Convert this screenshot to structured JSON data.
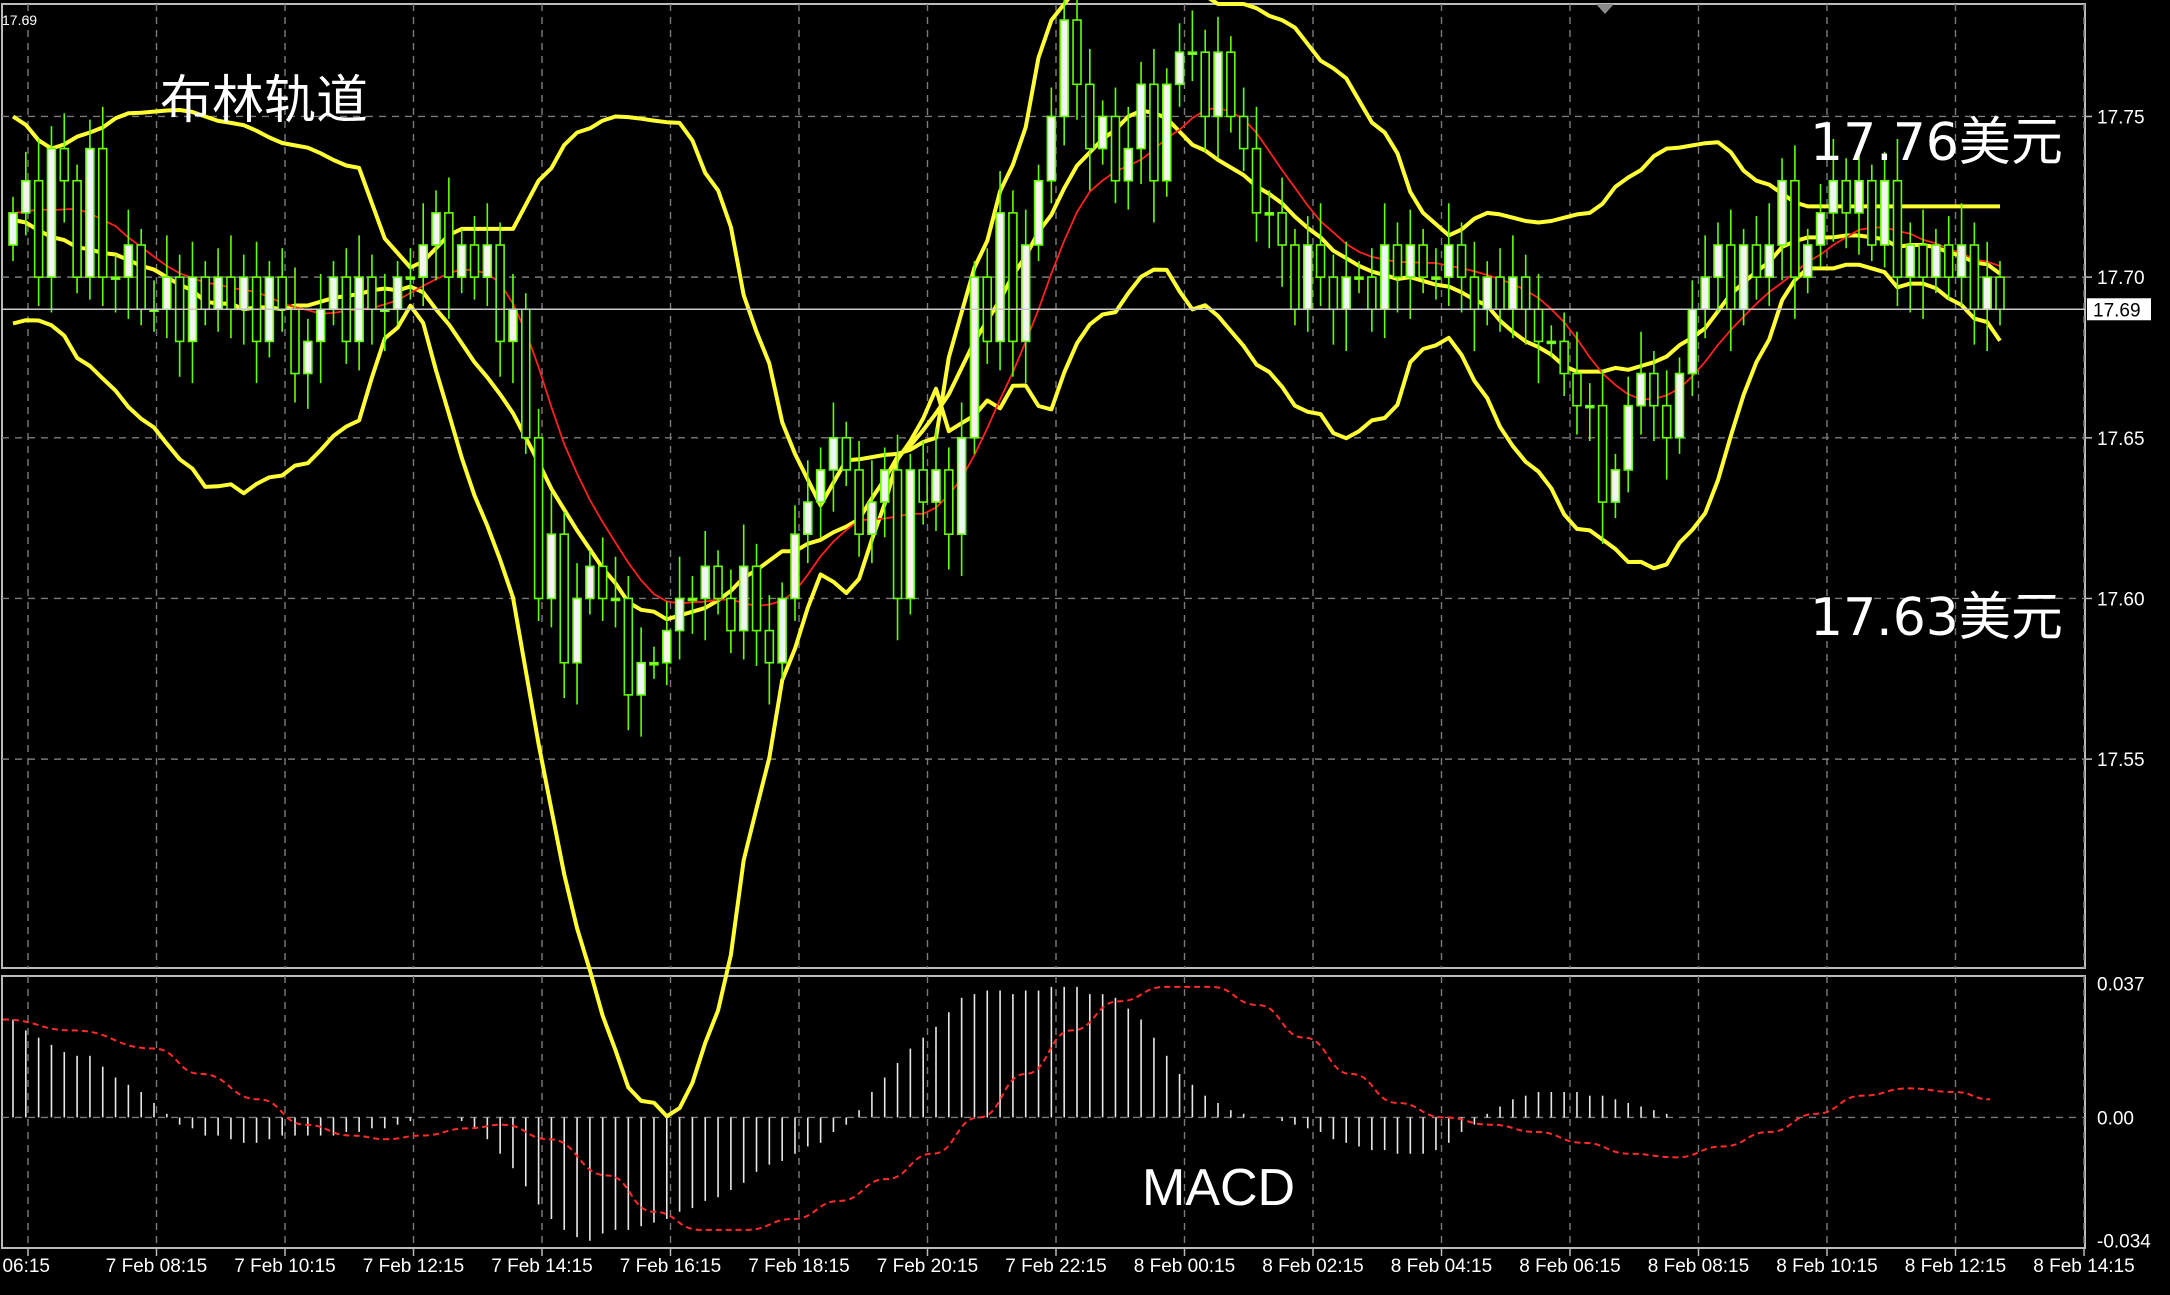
{
  "chart_data": [
    {
      "type": "candlestick",
      "title": "布林轨道",
      "corner_price": "17.69",
      "current_price": 17.69,
      "current_price_label": "17.69",
      "ylim": [
        17.485,
        17.785
      ],
      "y_ticks": [
        17.55,
        17.6,
        17.65,
        17.7,
        17.75
      ],
      "y_tick_labels": [
        "17.55",
        "17.60",
        "17.65",
        "17.70",
        "17.75"
      ],
      "x_ticks": [
        "06:15",
        "7 Feb 08:15",
        "7 Feb 10:15",
        "7 Feb 12:15",
        "7 Feb 14:15",
        "7 Feb 16:15",
        "7 Feb 18:15",
        "7 Feb 20:15",
        "7 Feb 22:15",
        "8 Feb 00:15",
        "8 Feb 02:15",
        "8 Feb 04:15",
        "8 Feb 06:15",
        "8 Feb 08:15",
        "8 Feb 10:15",
        "8 Feb 12:15",
        "8 Feb 14:15"
      ],
      "upper_band_annotation": "17.76美元",
      "lower_band_annotation": "17.63美元",
      "closes": [
        17.72,
        17.73,
        17.7,
        17.74,
        17.73,
        17.7,
        17.74,
        17.7,
        17.7,
        17.71,
        17.69,
        17.69,
        17.7,
        17.68,
        17.7,
        17.69,
        17.7,
        17.69,
        17.7,
        17.68,
        17.7,
        17.69,
        17.67,
        17.68,
        17.69,
        17.7,
        17.68,
        17.7,
        17.69,
        17.69,
        17.7,
        17.7,
        17.71,
        17.72,
        17.7,
        17.71,
        17.7,
        17.71,
        17.68,
        17.69,
        17.65,
        17.6,
        17.62,
        17.58,
        17.6,
        17.61,
        17.6,
        17.6,
        17.57,
        17.58,
        17.58,
        17.59,
        17.6,
        17.6,
        17.61,
        17.6,
        17.59,
        17.61,
        17.59,
        17.58,
        17.6,
        17.62,
        17.63,
        17.64,
        17.65,
        17.64,
        17.62,
        17.63,
        17.64,
        17.6,
        17.64,
        17.63,
        17.64,
        17.62,
        17.65,
        17.7,
        17.68,
        17.72,
        17.68,
        17.71,
        17.73,
        17.75,
        17.78,
        17.76,
        17.74,
        17.75,
        17.73,
        17.74,
        17.76,
        17.73,
        17.76,
        17.77,
        17.77,
        17.75,
        17.77,
        17.75,
        17.74,
        17.72,
        17.72,
        17.71,
        17.69,
        17.71,
        17.7,
        17.69,
        17.7,
        17.7,
        17.69,
        17.71,
        17.7,
        17.71,
        17.7,
        17.7,
        17.71,
        17.7,
        17.69,
        17.7,
        17.69,
        17.7,
        17.69,
        17.68,
        17.68,
        17.67,
        17.66,
        17.66,
        17.63,
        17.64,
        17.66,
        17.67,
        17.66,
        17.65,
        17.67,
        17.69,
        17.7,
        17.71,
        17.69,
        17.71,
        17.7,
        17.71,
        17.73,
        17.7,
        17.71,
        17.72,
        17.73,
        17.72,
        17.73,
        17.71,
        17.73,
        17.7,
        17.71,
        17.7,
        17.71,
        17.7,
        17.71,
        17.69,
        17.7,
        17.69
      ],
      "upper_band": [
        [
          0,
          17.75
        ],
        [
          3,
          17.74
        ],
        [
          6,
          17.745
        ],
        [
          9,
          17.751
        ],
        [
          13,
          17.752
        ],
        [
          17,
          17.748
        ],
        [
          22,
          17.741
        ],
        [
          27,
          17.734
        ],
        [
          29,
          17.712
        ],
        [
          31,
          17.703
        ],
        [
          35,
          17.715
        ],
        [
          39,
          17.715
        ],
        [
          41,
          17.73
        ],
        [
          44,
          17.745
        ],
        [
          47,
          17.75
        ],
        [
          52,
          17.748
        ],
        [
          55,
          17.727
        ],
        [
          58,
          17.683
        ],
        [
          61,
          17.645
        ],
        [
          63,
          17.629
        ],
        [
          65,
          17.643
        ],
        [
          69,
          17.645
        ],
        [
          72,
          17.65
        ],
        [
          73,
          17.675
        ],
        [
          75,
          17.703
        ],
        [
          78,
          17.735
        ],
        [
          81,
          17.78
        ],
        [
          83,
          17.79
        ],
        [
          87,
          17.805
        ],
        [
          91,
          17.795
        ],
        [
          94,
          17.785
        ],
        [
          96,
          17.785
        ],
        [
          99,
          17.78
        ],
        [
          103,
          17.765
        ],
        [
          107,
          17.745
        ],
        [
          110,
          17.72
        ],
        [
          112,
          17.713
        ],
        [
          115,
          17.72
        ],
        [
          119,
          17.717
        ],
        [
          123,
          17.72
        ],
        [
          126,
          17.731
        ],
        [
          129,
          17.74
        ],
        [
          133,
          17.742
        ],
        [
          136,
          17.73
        ],
        [
          140,
          17.722
        ]
      ]
    },
    {
      "type": "bar",
      "title": "MACD",
      "ylim": [
        -0.036,
        0.039
      ],
      "y_ticks": [
        0.037,
        0.0,
        -0.034
      ],
      "y_tick_labels": [
        "0.037",
        "0.00",
        "-0.034"
      ],
      "histogram": [
        0.027,
        0.024,
        0.022,
        0.02,
        0.018,
        0.017,
        0.017,
        0.014,
        0.011,
        0.009,
        0.007,
        0.004,
        0.001,
        -0.002,
        -0.003,
        -0.005,
        -0.005,
        -0.006,
        -0.007,
        -0.007,
        -0.006,
        -0.005,
        -0.005,
        -0.005,
        -0.005,
        -0.005,
        -0.004,
        -0.004,
        -0.003,
        -0.003,
        -0.002,
        -0.001,
        0.0,
        0.0,
        0.0,
        -0.001,
        -0.003,
        -0.006,
        -0.01,
        -0.014,
        -0.019,
        -0.024,
        -0.028,
        -0.031,
        -0.033,
        -0.034,
        -0.032,
        -0.031,
        -0.031,
        -0.03,
        -0.029,
        -0.028,
        -0.026,
        -0.025,
        -0.023,
        -0.022,
        -0.02,
        -0.018,
        -0.015,
        -0.013,
        -0.012,
        -0.01,
        -0.008,
        -0.007,
        -0.004,
        -0.002,
        0.002,
        0.007,
        0.011,
        0.015,
        0.019,
        0.022,
        0.025,
        0.029,
        0.033,
        0.034,
        0.035,
        0.035,
        0.034,
        0.035,
        0.035,
        0.036,
        0.036,
        0.036,
        0.034,
        0.034,
        0.033,
        0.03,
        0.027,
        0.022,
        0.017,
        0.012,
        0.009,
        0.006,
        0.004,
        0.002,
        0.001,
        0.0,
        0.0,
        -0.001,
        -0.002,
        -0.003,
        -0.004,
        -0.006,
        -0.007,
        -0.008,
        -0.009,
        -0.009,
        -0.01,
        -0.01,
        -0.01,
        -0.009,
        -0.007,
        -0.004,
        -0.002,
        0.001,
        0.003,
        0.005,
        0.006,
        0.007,
        0.007,
        0.007,
        0.007,
        0.006,
        0.006,
        0.005,
        0.004,
        0.003,
        0.002,
        0.001
      ],
      "signal": [
        [
          0,
          0.027
        ],
        [
          6,
          0.024
        ],
        [
          13,
          0.019
        ],
        [
          17,
          0.012
        ],
        [
          22,
          0.005
        ],
        [
          26,
          -0.002
        ],
        [
          30,
          -0.005
        ],
        [
          33,
          -0.006
        ],
        [
          36,
          -0.005
        ],
        [
          40,
          -0.003
        ],
        [
          43,
          -0.002
        ],
        [
          47,
          -0.006
        ],
        [
          52,
          -0.016
        ],
        [
          56,
          -0.026
        ],
        [
          60,
          -0.031
        ],
        [
          64,
          -0.031
        ],
        [
          68,
          -0.028
        ],
        [
          72,
          -0.023
        ],
        [
          76,
          -0.017
        ],
        [
          80,
          -0.01
        ],
        [
          84,
          0.0
        ],
        [
          88,
          0.012
        ],
        [
          92,
          0.024
        ],
        [
          96,
          0.032
        ],
        [
          100,
          0.036
        ],
        [
          104,
          0.036
        ],
        [
          108,
          0.031
        ],
        [
          112,
          0.022
        ],
        [
          116,
          0.012
        ],
        [
          120,
          0.004
        ],
        [
          124,
          0.0
        ],
        [
          128,
          -0.002
        ],
        [
          132,
          -0.004
        ],
        [
          136,
          -0.007
        ],
        [
          140,
          -0.01
        ],
        [
          144,
          -0.011
        ],
        [
          148,
          -0.008
        ],
        [
          152,
          -0.004
        ],
        [
          156,
          0.001
        ],
        [
          160,
          0.006
        ],
        [
          164,
          0.008
        ],
        [
          168,
          0.007
        ],
        [
          171,
          0.005
        ]
      ]
    }
  ]
}
